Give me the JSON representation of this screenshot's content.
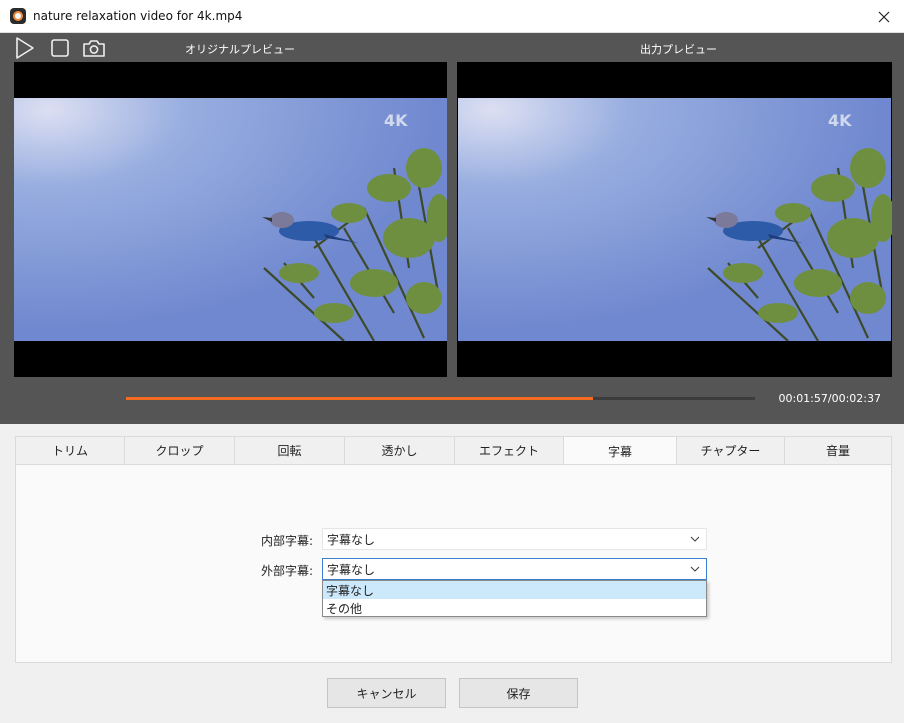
{
  "window": {
    "title": "nature relaxation video for 4k.mp4"
  },
  "preview": {
    "original_label": "オリジナルプレビュー",
    "output_label": "出力プレビュー",
    "watermark": "4K",
    "timecode": "00:01:57/00:02:37",
    "progress_fraction": 0.743
  },
  "tabs": [
    {
      "label": "トリム"
    },
    {
      "label": "クロップ"
    },
    {
      "label": "回転"
    },
    {
      "label": "透かし"
    },
    {
      "label": "エフェクト"
    },
    {
      "label": "字幕",
      "active": true
    },
    {
      "label": "チャプター"
    },
    {
      "label": "音量"
    }
  ],
  "subtitles": {
    "internal_label": "内部字幕:",
    "internal_value": "字幕なし",
    "external_label": "外部字幕:",
    "external_value": "字幕なし",
    "options": [
      "字幕なし",
      "その他"
    ]
  },
  "buttons": {
    "cancel": "キャンセル",
    "save": "保存"
  },
  "colors": {
    "accent": "#f26b21",
    "focus": "#3b7fd0",
    "highlight": "#cce8fb"
  }
}
